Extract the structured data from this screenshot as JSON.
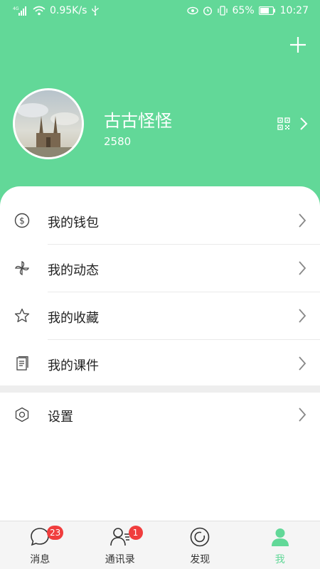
{
  "status_bar": {
    "network": "4G",
    "speed": "0.95K/s",
    "battery": "65%",
    "time": "10:27"
  },
  "profile": {
    "name": "古古怪怪",
    "id": "2580"
  },
  "menu": {
    "wallet": "我的钱包",
    "moments": "我的动态",
    "favorites": "我的收藏",
    "courseware": "我的课件",
    "settings": "设置"
  },
  "tabs": [
    {
      "label": "消息",
      "badge": "23"
    },
    {
      "label": "通讯录",
      "badge": "1"
    },
    {
      "label": "发现",
      "badge": ""
    },
    {
      "label": "我",
      "badge": ""
    }
  ],
  "colors": {
    "accent": "#62d898",
    "badge": "#f03d3d"
  }
}
